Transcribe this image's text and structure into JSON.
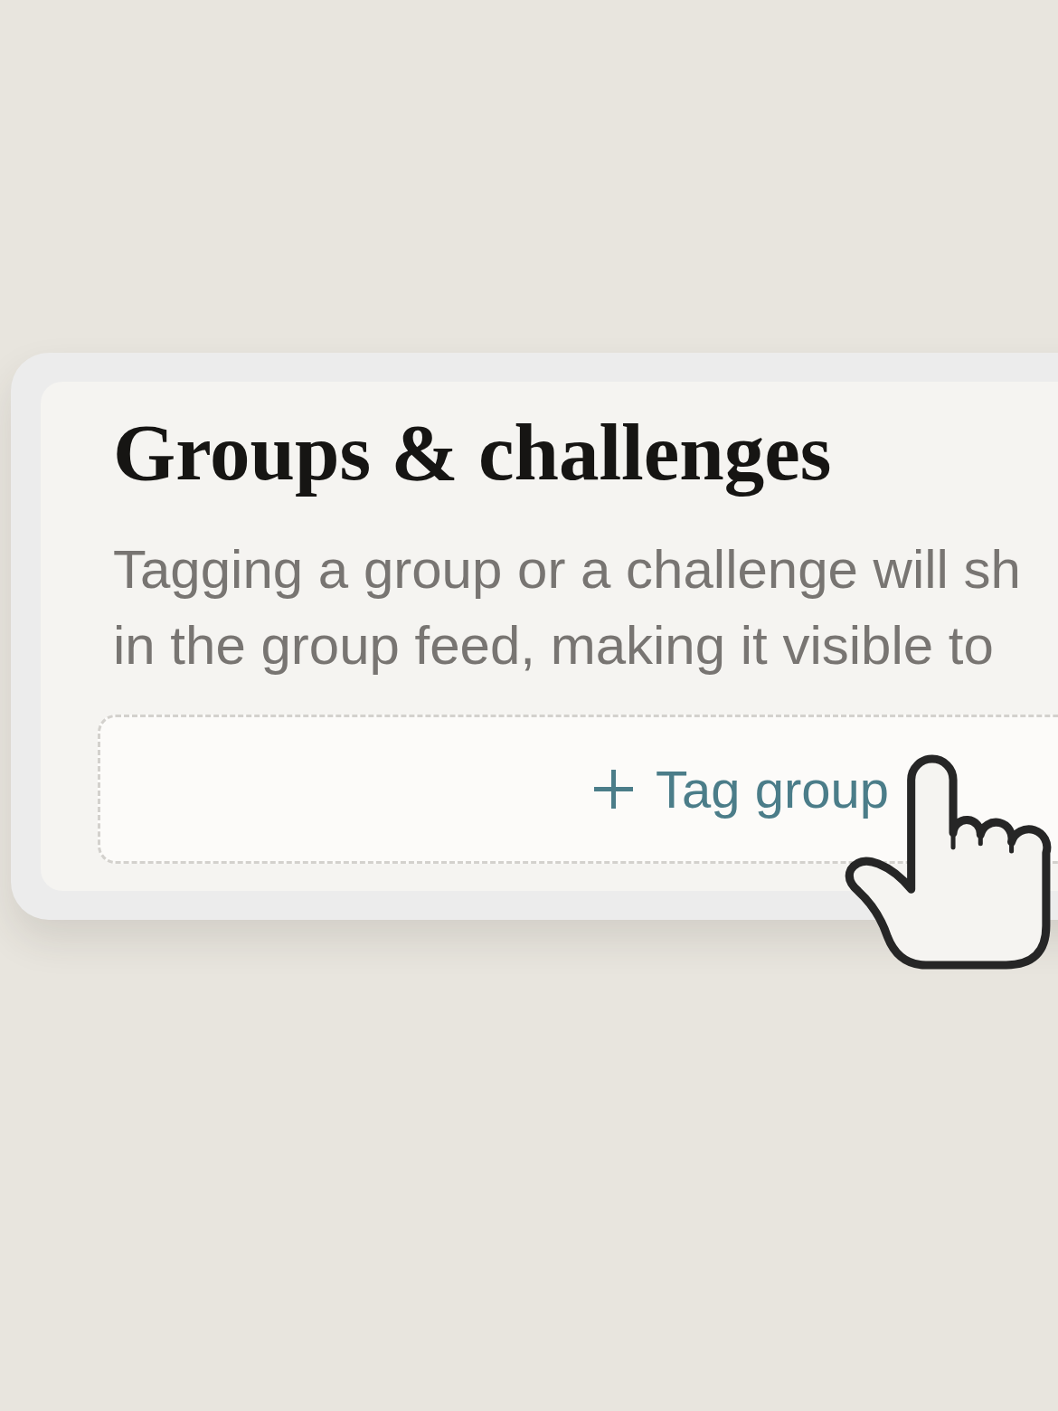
{
  "card": {
    "title": "Groups & challenges",
    "description_lines": [
      "Tagging a group or a challenge will sh",
      "in the group feed, making it visible to"
    ],
    "button": {
      "label": "Tag group"
    }
  }
}
